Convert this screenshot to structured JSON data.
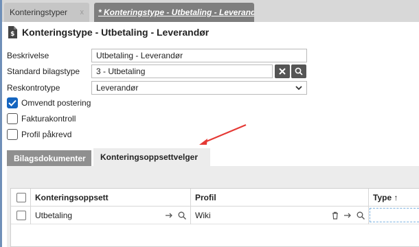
{
  "tabs": [
    {
      "label": "Konteringstyper",
      "close": "x"
    },
    {
      "label": "* Konteringstype - Utbetaling - Leverandør"
    }
  ],
  "header": {
    "title": "Konteringstype - Utbetaling - Leverandør",
    "icon": "document-dollar-icon"
  },
  "form": {
    "beskrivelse": {
      "label": "Beskrivelse",
      "value": "Utbetaling - Leverandør"
    },
    "bilagstype": {
      "label": "Standard bilagstype",
      "value": "3 - Utbetaling"
    },
    "reskontrotype": {
      "label": "Reskontrotype",
      "value": "Leverandør"
    },
    "checkboxes": [
      {
        "label": "Omvendt postering",
        "checked": true
      },
      {
        "label": "Fakturakontroll",
        "checked": false
      },
      {
        "label": "Profil påkrevd",
        "checked": false
      }
    ]
  },
  "subtabs": [
    {
      "label": "Bilagsdokumenter"
    },
    {
      "label": "Konteringsoppsettvelger"
    }
  ],
  "grid": {
    "columns": [
      {
        "label": "Konteringsoppsett"
      },
      {
        "label": "Profil"
      },
      {
        "label": "Type ↑"
      }
    ],
    "rows": [
      {
        "konteringsoppsett": "Utbetaling",
        "profil": "Wiki"
      }
    ]
  },
  "colors": {
    "accent": "#1565c0",
    "annotation_arrow": "#e53935",
    "active_tab": "#7e7e7e"
  }
}
